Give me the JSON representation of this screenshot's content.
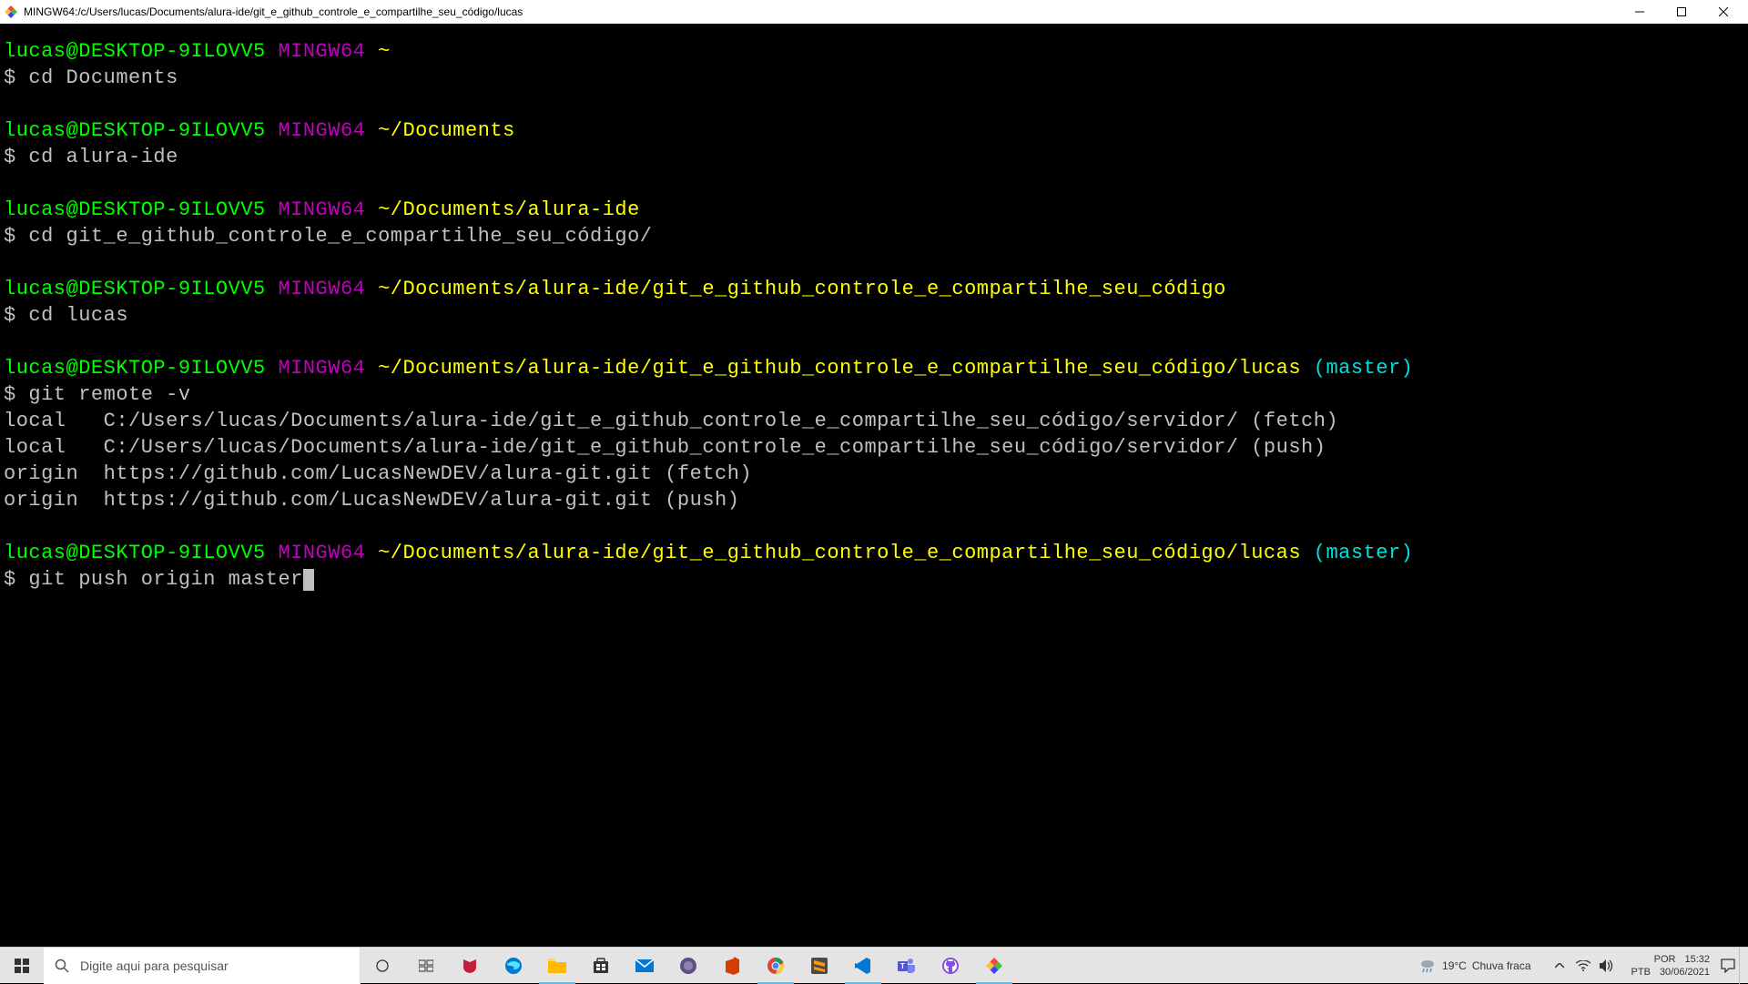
{
  "window": {
    "title": "MINGW64:/c/Users/lucas/Documents/alura-ide/git_e_github_controle_e_compartilhe_seu_código/lucas",
    "icon_colors": [
      "#ff4040",
      "#40c040",
      "#4040ff",
      "#ffc040"
    ]
  },
  "terminal": {
    "user_host": "lucas@DESKTOP-9ILOVV5",
    "mingw": "MINGW64",
    "blocks": [
      {
        "path": "~",
        "branch": "",
        "command": "cd Documents",
        "output": []
      },
      {
        "path": "~/Documents",
        "branch": "",
        "command": "cd alura-ide",
        "output": []
      },
      {
        "path": "~/Documents/alura-ide",
        "branch": "",
        "command": "cd git_e_github_controle_e_compartilhe_seu_código/",
        "output": []
      },
      {
        "path": "~/Documents/alura-ide/git_e_github_controle_e_compartilhe_seu_código",
        "branch": "",
        "command": "cd lucas",
        "output": []
      },
      {
        "path": "~/Documents/alura-ide/git_e_github_controle_e_compartilhe_seu_código/lucas",
        "branch": "(master)",
        "command": "git remote -v",
        "output": [
          "local   C:/Users/lucas/Documents/alura-ide/git_e_github_controle_e_compartilhe_seu_código/servidor/ (fetch)",
          "local   C:/Users/lucas/Documents/alura-ide/git_e_github_controle_e_compartilhe_seu_código/servidor/ (push)",
          "origin  https://github.com/LucasNewDEV/alura-git.git (fetch)",
          "origin  https://github.com/LucasNewDEV/alura-git.git (push)"
        ]
      },
      {
        "path": "~/Documents/alura-ide/git_e_github_controle_e_compartilhe_seu_código/lucas",
        "branch": "(master)",
        "command": "git push origin master",
        "output": [],
        "show_cursor": true
      }
    ],
    "dollar": "$ "
  },
  "taskbar": {
    "search_placeholder": "Digite aqui para pesquisar",
    "weather_temp": "19°C",
    "weather_desc": "Chuva fraca",
    "kb_lang": "POR",
    "kb_layout": "PTB",
    "time": "15:32",
    "date": "30/06/2021"
  }
}
